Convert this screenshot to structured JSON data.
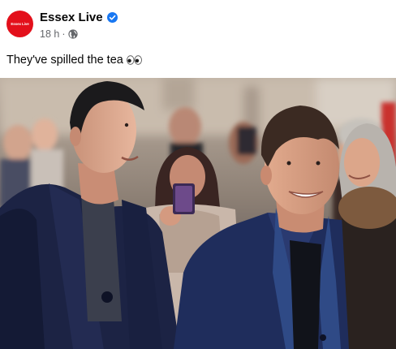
{
  "post": {
    "page_name": "Essex Live",
    "avatar_text": "Essex Live",
    "verified_icon": "verified-badge-icon",
    "timestamp": "18 h",
    "separator": "·",
    "audience_icon": "globe-icon",
    "text": "They've spilled the tea",
    "emoji_icon": "eyes-emoji-icon"
  },
  "colors": {
    "brand_red": "#e3101b",
    "verified_blue": "#1877f2",
    "meta_gray": "#65676b",
    "text": "#050505"
  }
}
